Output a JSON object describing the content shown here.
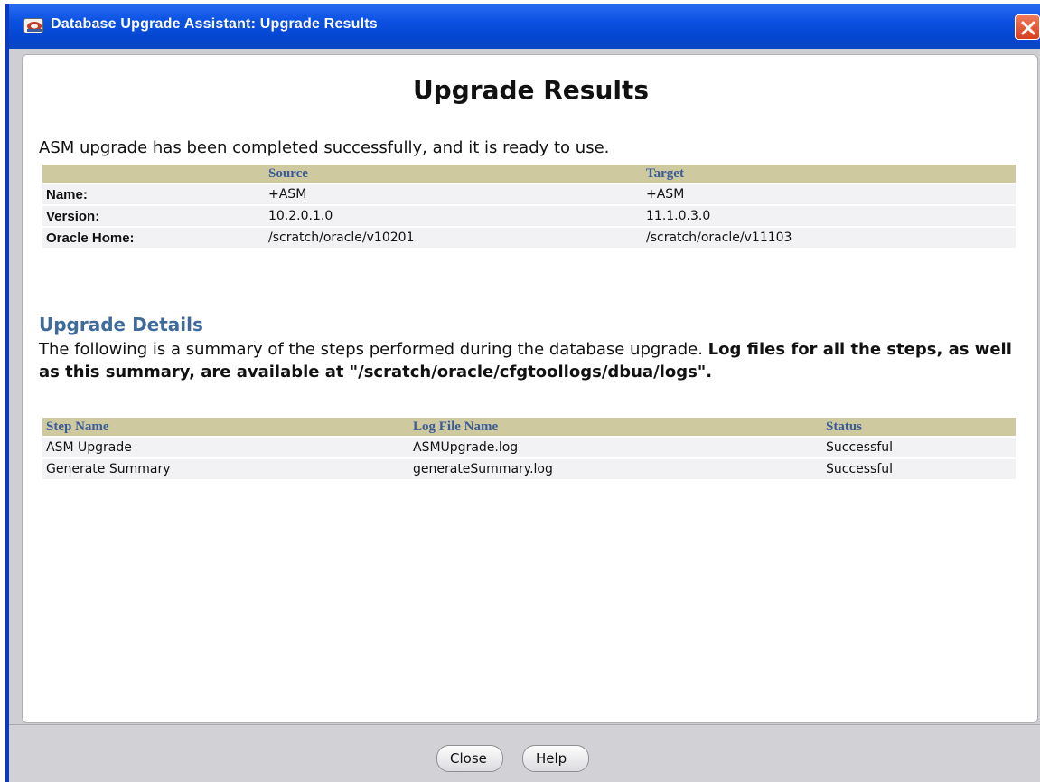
{
  "window": {
    "title": "Database Upgrade Assistant: Upgrade Results"
  },
  "page": {
    "heading": "Upgrade Results",
    "intro": "ASM upgrade has been completed successfully, and it is ready to use."
  },
  "summary_table": {
    "headers": [
      "",
      "Source",
      "Target"
    ],
    "rows": [
      {
        "label": "Name:",
        "source": "+ASM",
        "target": "+ASM"
      },
      {
        "label": "Version:",
        "source": "10.2.0.1.0",
        "target": "11.1.0.3.0"
      },
      {
        "label": "Oracle Home:",
        "source": "/scratch/oracle/v10201",
        "target": "/scratch/oracle/v11103"
      }
    ]
  },
  "details": {
    "heading": "Upgrade Details",
    "text_plain": "The following is a summary of the steps performed during the database upgrade. ",
    "text_bold": "Log files for all the steps, as well as this summary, are available at \"/scratch/oracle/cfgtoollogs/dbua/logs\"."
  },
  "steps_table": {
    "headers": [
      "Step Name",
      "Log File Name",
      "Status"
    ],
    "rows": [
      {
        "step": "ASM Upgrade",
        "log": "ASMUpgrade.log",
        "status": "Successful"
      },
      {
        "step": "Generate Summary",
        "log": "generateSummary.log",
        "status": "Successful"
      }
    ]
  },
  "buttons": {
    "close": "Close",
    "help": "Help"
  },
  "icons": {
    "app": "oracle-app-icon",
    "close": "close-icon"
  },
  "colors": {
    "titlebar": "#0a50e0",
    "table_header": "#cfc9a0",
    "header_text": "#3a5d9a",
    "section_heading": "#3f6a9a"
  }
}
